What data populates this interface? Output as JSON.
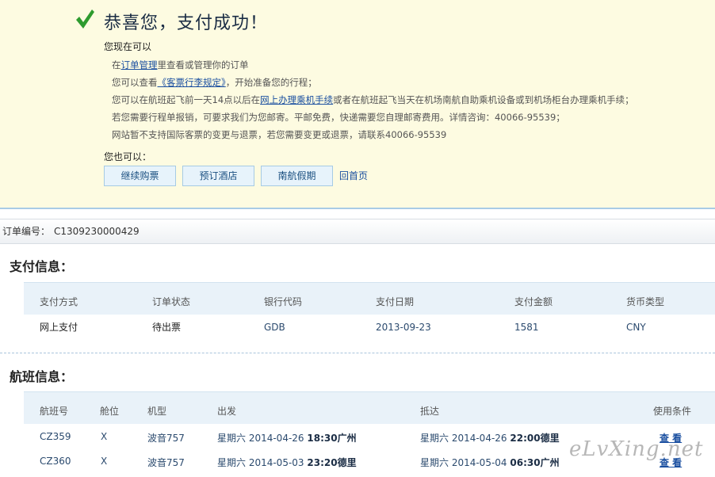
{
  "success": {
    "title": "恭喜您，支付成功！",
    "now_you_can": "您现在可以",
    "lines": [
      {
        "pre": "在",
        "link": "订单管理",
        "post": "里查看或管理你的订单"
      },
      {
        "pre": "您可以查看",
        "link": "《客票行李规定》",
        "post": "，开始准备您的行程；"
      },
      {
        "pre": "您可以在航班起飞前一天14点以后在",
        "link": "网上办理乘机手续",
        "post": "或者在航班起飞当天在机场南航自助乘机设备或到机场柜台办理乘机手续；"
      },
      {
        "text": "若您需要行程单报销，可要求我们为您邮寄。平邮免费，快递需要您自理邮寄费用。详情咨询：40066-95539；"
      },
      {
        "text": "网站暂不支持国际客票的变更与退票，若您需要变更或退票，请联系40066-95539"
      }
    ],
    "also_can": "您也可以：",
    "buttons": [
      "继续购票",
      "预订酒店",
      "南航假期"
    ],
    "home_link": "回首页"
  },
  "order": {
    "label": "订单编号：",
    "number": "C1309230000429"
  },
  "payment": {
    "title": "支付信息：",
    "headers": [
      "支付方式",
      "订单状态",
      "银行代码",
      "支付日期",
      "支付金额",
      "货币类型"
    ],
    "row": [
      "网上支付",
      "待出票",
      "GDB",
      "2013-09-23",
      "1581",
      "CNY"
    ]
  },
  "flights": {
    "title": "航班信息：",
    "headers": [
      "航班号",
      "舱位",
      "机型",
      "出发",
      "抵达",
      "使用条件"
    ],
    "rows": [
      {
        "flight": "CZ359",
        "cabin": "X",
        "aircraft": "波音757",
        "dep_date": "星期六 2014-04-26 ",
        "dep_time_city": "18:30广州",
        "arr_date": "星期六 2014-04-26 ",
        "arr_time_city": "22:00德里",
        "view": "查 看"
      },
      {
        "flight": "CZ360",
        "cabin": "X",
        "aircraft": "波音757",
        "dep_date": "星期六 2014-05-03 ",
        "dep_time_city": "23:20德里",
        "arr_date": "星期六 2014-05-04 ",
        "arr_time_city": "06:30广州",
        "view": "查 看"
      }
    ]
  },
  "watermark": "eLvXing.net",
  "colors": {
    "check_green": "#2e9b2e",
    "panel_bg": "#fdfbe1",
    "link": "#1a4fa0"
  }
}
